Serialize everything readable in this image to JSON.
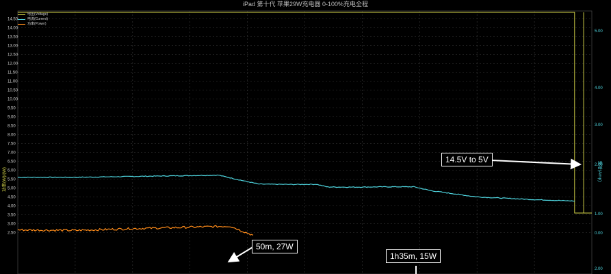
{
  "chart_data": {
    "type": "line",
    "title": "iPad 第十代 苹果29W充电器 0-100%充电全程",
    "y_left_label": "功率(W)/(W)",
    "y_right_label": "安培(Amp)",
    "y_left_ticks": [
      "14.50",
      "14.00",
      "13.50",
      "13.00",
      "12.50",
      "12.00",
      "11.50",
      "11.00",
      "10.50",
      "10.00",
      "9.50",
      "9.00",
      "8.50",
      "8.00",
      "7.50",
      "7.00",
      "6.50",
      "6.00",
      "5.50",
      "5.00",
      "4.50",
      "4.00",
      "3.50",
      "3.00",
      "2.50"
    ],
    "y_left_range": [
      2.4,
      14.7
    ],
    "y_right_ticks": [
      "5.00",
      "4.00",
      "3.00",
      "2.00",
      "1.00",
      "0.00",
      "2.00"
    ],
    "legend": [
      {
        "label": "电压(Voltage)",
        "color": "#d8d84a"
      },
      {
        "label": "电流(Current)",
        "color": "#4fd6e0"
      },
      {
        "label": "功率(Power)",
        "color": "#ff8c1a"
      }
    ],
    "series": [
      {
        "name": "电压(Voltage)",
        "color": "#d8d84a",
        "x": [
          0,
          0.97,
          0.97,
          1.0
        ],
        "values": [
          14.85,
          14.85,
          5.15,
          5.15
        ]
      },
      {
        "name": "电流(Current)",
        "color": "#4fd6e0",
        "x": [
          0,
          0.1,
          0.2,
          0.3,
          0.35,
          0.38,
          0.42,
          0.48,
          0.52,
          0.54,
          0.58,
          0.65,
          0.69,
          0.72,
          0.8,
          0.9,
          0.97
        ],
        "values": [
          5.6,
          5.6,
          5.65,
          5.7,
          5.72,
          5.5,
          5.22,
          5.2,
          5.21,
          5.06,
          5.05,
          5.07,
          5.07,
          4.85,
          4.5,
          4.35,
          4.27
        ]
      },
      {
        "name": "功率(Power)",
        "color": "#ff8c1a",
        "x": [
          0,
          0.1,
          0.2,
          0.3,
          0.37,
          0.39,
          0.41
        ],
        "values": [
          2.65,
          2.62,
          2.72,
          2.8,
          2.86,
          2.6,
          2.35
        ]
      }
    ],
    "annotations": [
      {
        "text": "14.5V to 5V"
      },
      {
        "text": "50m, 27W"
      },
      {
        "text": "1h35m, 15W"
      }
    ]
  }
}
